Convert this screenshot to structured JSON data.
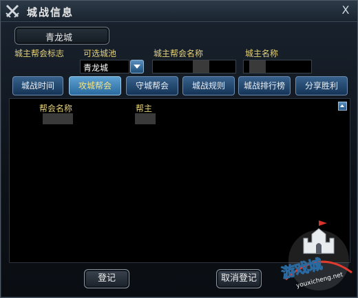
{
  "window": {
    "title": "城战信息",
    "close_glyph": "X"
  },
  "city": {
    "name": "青龙城"
  },
  "labels": {
    "leader_emblem": "城主帮会标志",
    "selectable_city": "可选城池",
    "leader_guild_name": "城主帮会名称",
    "leader_name": "城主名称"
  },
  "city_select": {
    "value": "青龙城"
  },
  "tabs": [
    {
      "label": "城战时间"
    },
    {
      "label": "攻城帮会"
    },
    {
      "label": "守城帮会"
    },
    {
      "label": "城战规则"
    },
    {
      "label": "城战排行榜"
    },
    {
      "label": "分享胜利"
    }
  ],
  "active_tab": "攻城帮会",
  "table": {
    "headers": {
      "guild_name": "帮会名称",
      "leader": "帮主"
    }
  },
  "buttons": {
    "register": "登记",
    "cancel_register": "取消登记"
  },
  "watermark": {
    "text": "游戏城",
    "url": "youxicheng.net"
  },
  "colors": {
    "accent_yellow": "#e5d27a",
    "tab_blue": "#2a6aa0"
  }
}
